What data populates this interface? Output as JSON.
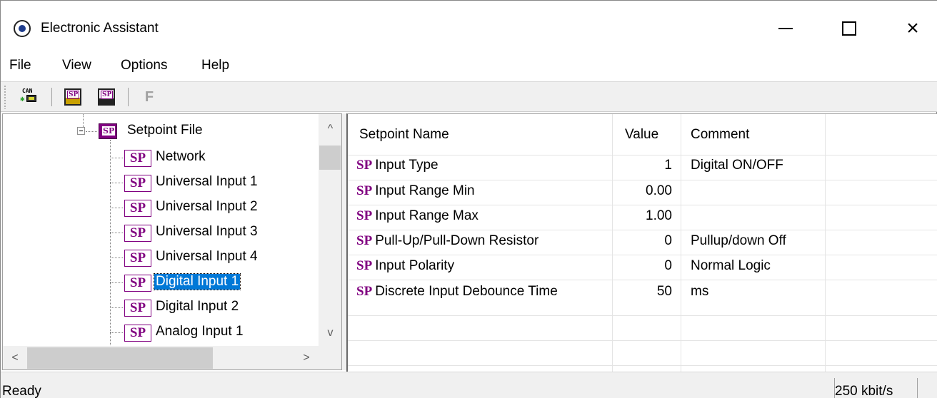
{
  "window": {
    "title": "Electronic Assistant",
    "minimize": "minimize",
    "maximize": "maximize",
    "close": "×"
  },
  "menu": [
    "File",
    "View",
    "Options",
    "Help"
  ],
  "toolbar": {
    "can_label": "CAN",
    "sp_tag": "SP",
    "f_label": "F"
  },
  "tree": {
    "root": "Setpoint File",
    "sp_tag": "SP",
    "items": [
      "Network",
      "Universal Input 1",
      "Universal Input 2",
      "Universal Input 3",
      "Universal Input 4",
      "Digital Input 1",
      "Digital Input 2",
      "Analog Input 1"
    ],
    "selected": "Digital Input 1",
    "scroll_up": "^",
    "scroll_down": "v",
    "scroll_left": "<",
    "scroll_right": ">"
  },
  "table": {
    "headers": [
      "Setpoint Name",
      "Value",
      "Comment"
    ],
    "sp_tag": "SP",
    "rows": [
      {
        "name": "Input Type",
        "value": "1",
        "comment": "Digital ON/OFF"
      },
      {
        "name": "Input Range Min",
        "value": "0.00",
        "comment": ""
      },
      {
        "name": "Input Range Max",
        "value": "1.00",
        "comment": ""
      },
      {
        "name": "Pull-Up/Pull-Down Resistor",
        "value": "0",
        "comment": "Pullup/down Off"
      },
      {
        "name": "Input Polarity",
        "value": "0",
        "comment": "Normal Logic"
      },
      {
        "name": "Discrete Input Debounce Time",
        "value": "50",
        "comment": "ms"
      }
    ]
  },
  "status": {
    "text": "Ready",
    "bitrate": "250 kbit/s"
  },
  "colors": {
    "sp_purple": "#800080",
    "selection": "#0078d7"
  }
}
